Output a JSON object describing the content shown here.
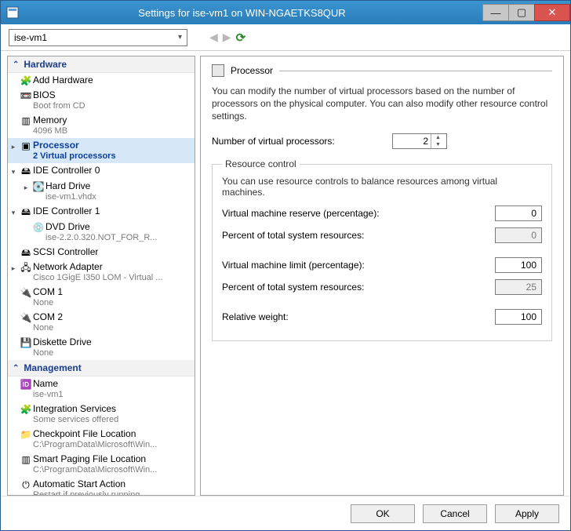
{
  "window": {
    "title": "Settings for ise-vm1 on WIN-NGAETKS8QUR"
  },
  "toolbar": {
    "selected_vm": "ise-vm1"
  },
  "tree": {
    "hardware_label": "Hardware",
    "management_label": "Management",
    "items": {
      "add_hw": "Add Hardware",
      "bios": "BIOS",
      "bios_sub": "Boot from CD",
      "memory": "Memory",
      "memory_sub": "4096 MB",
      "processor": "Processor",
      "processor_sub": "2 Virtual processors",
      "ide0": "IDE Controller 0",
      "hdd": "Hard Drive",
      "hdd_sub": "ise-vm1.vhdx",
      "ide1": "IDE Controller 1",
      "dvd": "DVD Drive",
      "dvd_sub": "ise-2.2.0.320.NOT_FOR_R...",
      "scsi": "SCSI Controller",
      "net": "Network Adapter",
      "net_sub": "Cisco 1GigE I350 LOM - Virtual ...",
      "com1": "COM 1",
      "com1_sub": "None",
      "com2": "COM 2",
      "com2_sub": "None",
      "diskette": "Diskette Drive",
      "diskette_sub": "None",
      "name": "Name",
      "name_sub": "ise-vm1",
      "integ": "Integration Services",
      "integ_sub": "Some services offered",
      "checkpoint": "Checkpoint File Location",
      "checkpoint_sub": "C:\\ProgramData\\Microsoft\\Win...",
      "smart": "Smart Paging File Location",
      "smart_sub": "C:\\ProgramData\\Microsoft\\Win...",
      "autostart": "Automatic Start Action",
      "autostart_sub": "Restart if previously running"
    }
  },
  "panel": {
    "heading": "Processor",
    "description": "You can modify the number of virtual processors based on the number of processors on the physical computer. You can also modify other resource control settings.",
    "vproc_label": "Number of virtual processors:",
    "vproc_value": "2",
    "rc_legend": "Resource control",
    "rc_desc": "You can use resource controls to balance resources among virtual machines.",
    "reserve_label": "Virtual machine reserve (percentage):",
    "reserve_value": "0",
    "reserve_total_label": "Percent of total system resources:",
    "reserve_total_value": "0",
    "limit_label": "Virtual machine limit (percentage):",
    "limit_value": "100",
    "limit_total_label": "Percent of total system resources:",
    "limit_total_value": "25",
    "weight_label": "Relative weight:",
    "weight_value": "100"
  },
  "buttons": {
    "ok": "OK",
    "cancel": "Cancel",
    "apply": "Apply"
  }
}
